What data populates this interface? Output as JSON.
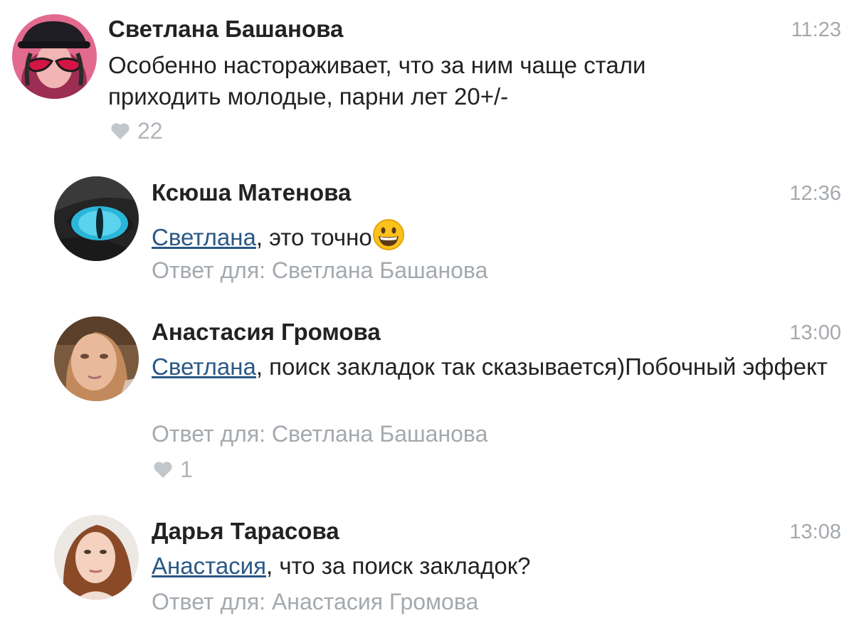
{
  "comments": [
    {
      "author": "Светлана Башанова",
      "time": "11:23",
      "text": "Особенно настораживает, что за ним чаще стали приходить молодые,  парни лет 20+/-",
      "likes": "22"
    },
    {
      "author": "Ксюша Матенова",
      "time": "12:36",
      "mention": "Светлана",
      "text": ", это точно",
      "emoji": "grinning-face",
      "reply_to": "Ответ для: Светлана Башанова"
    },
    {
      "author": "Анастасия Громова",
      "time": "13:00",
      "mention": "Светлана",
      "text": ", поиск закладок так сказывается)Побочный эффект",
      "reply_to": "Ответ для: Светлана Башанова",
      "likes": "1"
    },
    {
      "author": "Дарья Тарасова",
      "time": "13:08",
      "mention": "Анастасия",
      "text": ", что за поиск закладок?",
      "reply_to": "Ответ для: Анастасия Громова"
    }
  ],
  "icons": {
    "like": "heart-icon",
    "emoji": "grinning-face-emoji"
  },
  "colors": {
    "mention": "#2a5885",
    "muted": "#a4a9ae",
    "text": "#222222"
  }
}
